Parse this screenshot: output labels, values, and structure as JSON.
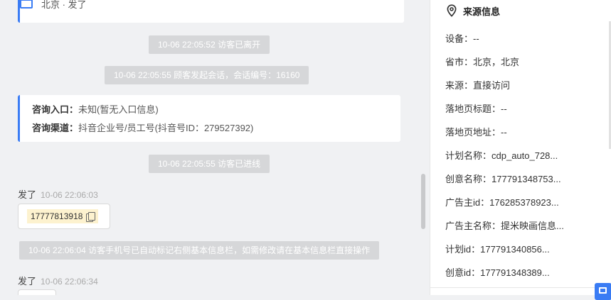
{
  "top_card": {
    "location": "北京 · 发了"
  },
  "messages": {
    "visitor_left": "10-06 22:05:52 访客已离开",
    "session_start": "10-06 22:05:55 顾客发起会话，会话编号：16160",
    "entry": {
      "entry_label": "咨询入口：",
      "entry_value": "未知(暂无入口信息)",
      "channel_label": "咨询渠道：",
      "channel_value": "抖音企业号/员工号(抖音号ID：279527392)"
    },
    "visitor_entered": "10-06 22:05:55 访客已进线",
    "msg1": {
      "sender": "发了",
      "time": "10-06 22:06:03",
      "phone": "17777813918"
    },
    "auto_mark": "10-06 22:06:04 访客手机号已自动标记右侧基本信息栏，如需修改请在基本信息栏直接操作",
    "msg2": {
      "sender": "发了",
      "time": "10-06 22:06:34"
    }
  },
  "panel": {
    "title": "来源信息",
    "fields": [
      "设备：--",
      "省市：北京，北京",
      "来源：直接访问",
      "落地页标题：--",
      "落地页地址：--",
      "计划名称：cdp_auto_728...",
      "创意名称：177791348753...",
      "广告主id：176285378923...",
      "广告主名称：提米映画信息...",
      "计划id：177791340856...",
      "创意id：177791348389..."
    ]
  },
  "colors": {
    "accent": "#3a7cf4",
    "system_bubble": "#d6d7d9",
    "phone_highlight": "#fdf2cf"
  },
  "icons": [
    "chat-window-icon",
    "location-pin-icon",
    "copy-icon",
    "chat-toggle-icon"
  ]
}
